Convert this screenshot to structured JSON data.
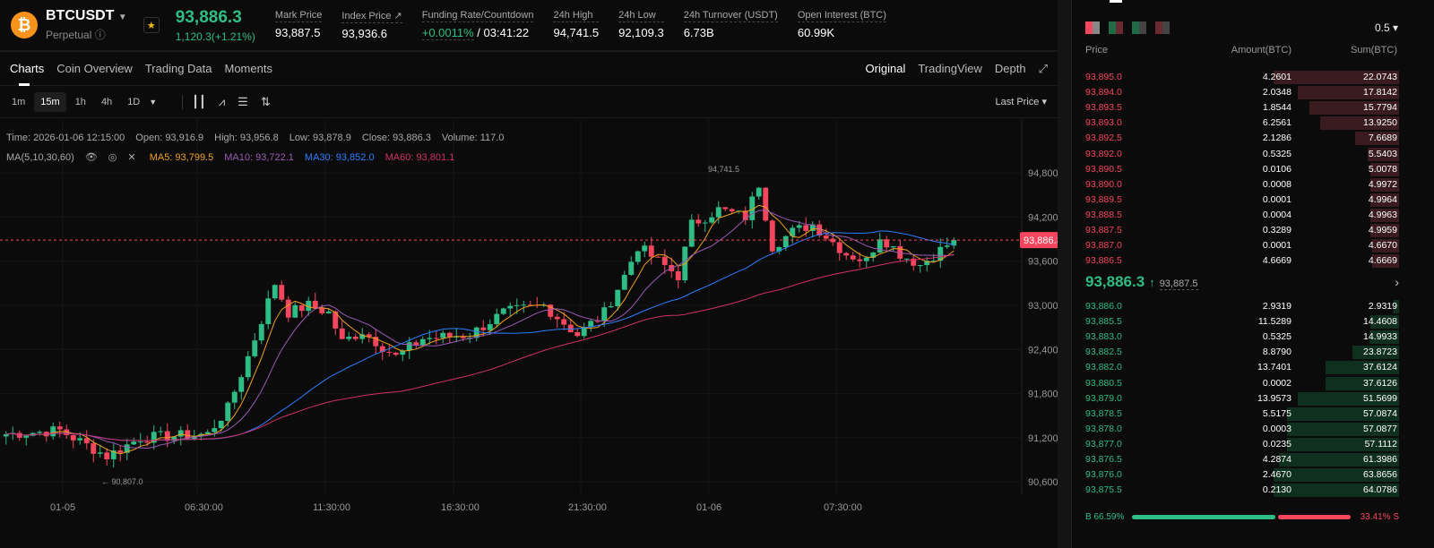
{
  "header": {
    "symbol": "BTCUSDT",
    "type": "Perpetual",
    "last": "93,886.3",
    "change": "1,120.3(+1.21%)",
    "stats": [
      {
        "k": "Mark Price",
        "v": "93,887.5"
      },
      {
        "k": "Index Price ↗",
        "v": "93,936.6"
      },
      {
        "k": "Funding Rate/Countdown",
        "v": "+0.0011%",
        "v2": " / 03:41:22"
      },
      {
        "k": "24h High",
        "v": "94,741.5"
      },
      {
        "k": "24h Low",
        "v": "92,109.3"
      },
      {
        "k": "24h Turnover (USDT)",
        "v": "6.73B"
      },
      {
        "k": "Open Interest (BTC)",
        "v": "60.99K"
      }
    ]
  },
  "tabs": [
    "Charts",
    "Coin Overview",
    "Trading Data",
    "Moments"
  ],
  "views": [
    "Original",
    "TradingView",
    "Depth"
  ],
  "intervals": [
    "1m",
    "15m",
    "1h",
    "4h",
    "1D"
  ],
  "last_price_label": "Last Price",
  "info": {
    "time": "Time: 2026-01-06 12:15:00",
    "open": "Open: 93,916.9",
    "high": "High: 93,956.8",
    "low": "Low: 93,878.9",
    "close": "Close: 93,886.3",
    "volume": "Volume: 117.0",
    "ma": "MA(5,10,30,60)",
    "ma5": "MA5: 93,799.5",
    "ma10": "MA10: 93,722.1",
    "ma30": "MA30: 93,852.0",
    "ma60": "MA60: 93,801.1"
  },
  "chart_data": {
    "type": "candlestick",
    "y_ticks": [
      94800,
      94200,
      93600,
      93000,
      92400,
      91800,
      91200,
      90600
    ],
    "y_tick_labels": [
      "94,800.0",
      "94,200.0",
      "93,600.0",
      "93,000.0",
      "92,400.0",
      "91,800.0",
      "91,200.0",
      "90,600.0"
    ],
    "x_labels": [
      "01-05",
      "06:30:00",
      "11:30:00",
      "16:30:00",
      "21:30:00",
      "01-06",
      "07:30:00"
    ],
    "current_price": 93886.3,
    "current_label": "93,886.3",
    "high_mark": "94,741.5",
    "low_mark": "← 90,807.0",
    "close_path": [
      [
        0,
        91250
      ],
      [
        8,
        91300
      ],
      [
        14,
        91000
      ],
      [
        15,
        90950
      ],
      [
        20,
        91200
      ],
      [
        30,
        91250
      ],
      [
        33,
        91600
      ],
      [
        36,
        92300
      ],
      [
        38,
        92800
      ],
      [
        40,
        93300
      ],
      [
        42,
        92900
      ],
      [
        45,
        93000
      ],
      [
        48,
        92900
      ],
      [
        50,
        92500
      ],
      [
        53,
        92650
      ],
      [
        58,
        92300
      ],
      [
        62,
        92550
      ],
      [
        69,
        92600
      ],
      [
        74,
        92900
      ],
      [
        80,
        93000
      ],
      [
        85,
        92600
      ],
      [
        89,
        92900
      ],
      [
        92,
        93400
      ],
      [
        94,
        93800
      ],
      [
        97,
        93600
      ],
      [
        100,
        93400
      ],
      [
        102,
        94100
      ],
      [
        106,
        94300
      ],
      [
        110,
        94200
      ],
      [
        112,
        94650
      ],
      [
        114,
        93800
      ],
      [
        117,
        94000
      ],
      [
        120,
        94100
      ],
      [
        125,
        93700
      ],
      [
        128,
        93600
      ],
      [
        130,
        93950
      ],
      [
        133,
        93700
      ],
      [
        136,
        93550
      ],
      [
        141,
        93886
      ]
    ],
    "colors": {
      "up": "#2ebd85",
      "down": "#f6465d",
      "ma5": "#f0a020",
      "ma10": "#9b59b6",
      "ma30": "#2a7fff",
      "ma60": "#d1306a"
    }
  },
  "orderbook": {
    "tick": "0.5",
    "headers": [
      "Price",
      "Amount(BTC)",
      "Sum(BTC)"
    ],
    "asks": [
      [
        "93,895.0",
        "4.2601",
        "22.0743"
      ],
      [
        "93,894.0",
        "2.0348",
        "17.8142"
      ],
      [
        "93,893.5",
        "1.8544",
        "15.7794"
      ],
      [
        "93,893.0",
        "6.2561",
        "13.9250"
      ],
      [
        "93,892.5",
        "2.1286",
        "7.6689"
      ],
      [
        "93,892.0",
        "0.5325",
        "5.5403"
      ],
      [
        "93,890.5",
        "0.0106",
        "5.0078"
      ],
      [
        "93,890.0",
        "0.0008",
        "4.9972"
      ],
      [
        "93,889.5",
        "0.0001",
        "4.9964"
      ],
      [
        "93,888.5",
        "0.0004",
        "4.9963"
      ],
      [
        "93,887.5",
        "0.3289",
        "4.9959"
      ],
      [
        "93,887.0",
        "0.0001",
        "4.6670"
      ],
      [
        "93,886.5",
        "4.6669",
        "4.6669"
      ]
    ],
    "mid": "93,886.3",
    "mid_arrow": "↑",
    "mark": "93,887.5",
    "bids": [
      [
        "93,886.0",
        "2.9319",
        "2.9319"
      ],
      [
        "93,885.5",
        "11.5289",
        "14.4608"
      ],
      [
        "93,883.0",
        "0.5325",
        "14.9933"
      ],
      [
        "93,882.5",
        "8.8790",
        "23.8723"
      ],
      [
        "93,882.0",
        "13.7401",
        "37.6124"
      ],
      [
        "93,880.5",
        "0.0002",
        "37.6126"
      ],
      [
        "93,879.0",
        "13.9573",
        "51.5699"
      ],
      [
        "93,878.5",
        "5.5175",
        "57.0874"
      ],
      [
        "93,878.0",
        "0.0003",
        "57.0877"
      ],
      [
        "93,877.0",
        "0.0235",
        "57.1112"
      ],
      [
        "93,876.5",
        "4.2874",
        "61.3986"
      ],
      [
        "93,876.0",
        "2.4670",
        "63.8656"
      ],
      [
        "93,875.5",
        "0.2130",
        "64.0786"
      ]
    ],
    "buy": "B 66.59%",
    "sell": "33.41% S",
    "buy_pct": 66.59
  }
}
